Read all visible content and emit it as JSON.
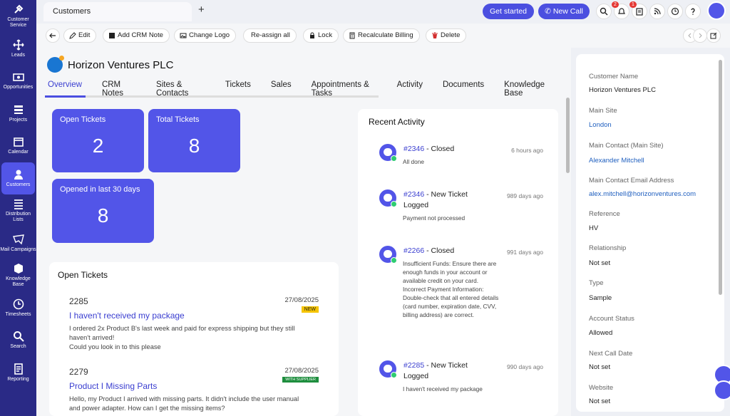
{
  "sidebar": {
    "items": [
      {
        "label": "Customer Service",
        "icon": "wrench-icon"
      },
      {
        "label": "Leads",
        "icon": "move-icon"
      },
      {
        "label": "Opportunities",
        "icon": "money-icon"
      },
      {
        "label": "Projects",
        "icon": "projects-icon"
      },
      {
        "label": "Calendar",
        "icon": "calendar-icon"
      },
      {
        "label": "Customers",
        "icon": "user-icon"
      },
      {
        "label": "Distribution Lists",
        "icon": "list-icon"
      },
      {
        "label": "Mail Campaigns",
        "icon": "mail-icon"
      },
      {
        "label": "Knowledge Base",
        "icon": "box-icon"
      },
      {
        "label": "Timesheets",
        "icon": "clock-icon"
      },
      {
        "label": "Search",
        "icon": "search-icon"
      },
      {
        "label": "Reporting",
        "icon": "report-icon"
      }
    ],
    "active_index": 5
  },
  "topbar": {
    "tab_label": "Customers",
    "plus": "+",
    "get_started": "Get started",
    "new_call": "New Call",
    "notif_badge": "2",
    "tasks_badge": "1"
  },
  "toolbar": {
    "edit": "Edit",
    "add_crm_note": "Add CRM Note",
    "change_logo": "Change Logo",
    "reassign": "Re-assign all",
    "lock": "Lock",
    "recalc": "Recalculate Billing",
    "delete": "Delete"
  },
  "customer": {
    "name": "Horizon Ventures PLC"
  },
  "tabs": [
    "Overview",
    "CRM Notes",
    "Sites & Contacts",
    "Tickets",
    "Sales",
    "Appointments & Tasks",
    "Activity",
    "Documents",
    "Knowledge Base"
  ],
  "stats": {
    "open_tickets_label": "Open Tickets",
    "open_tickets_value": "2",
    "total_tickets_label": "Total Tickets",
    "total_tickets_value": "8",
    "opened_30_label": "Opened in last 30 days",
    "opened_30_value": "8"
  },
  "open_tickets": {
    "title": "Open Tickets",
    "items": [
      {
        "id": "2285",
        "date": "27/08/2025",
        "tag": "NEW",
        "title": "I haven't received my package",
        "desc1": "I ordered 2x Product B's last week and paid for express shipping but they still",
        "desc2": "haven't arrived!",
        "desc3": "Could you look in to this please"
      },
      {
        "id": "2279",
        "date": "27/08/2025",
        "tag": "WITH SUPPLIER",
        "title": "Product I Missing Parts",
        "desc1": "Hello, my Product I arrived with missing parts. It didn't include the user manual",
        "desc2": "and power adapter. How can I get the missing items?"
      }
    ]
  },
  "recent_activity": {
    "title": "Recent Activity",
    "items": [
      {
        "ref": "#2346",
        "text": " - Closed",
        "time": "6 hours ago",
        "desc": "All done"
      },
      {
        "ref": "#2346",
        "text": " - New Ticket Logged",
        "time": "989 days ago",
        "desc": "Payment not processed"
      },
      {
        "ref": "#2266",
        "text": " - Closed",
        "time": "991 days ago",
        "desc": "Insufficient Funds: Ensure there are enough funds in your account or available credit on your card. Incorrect Payment Information: Double-check that all entered details (card number, expiration date, CVV, billing address) are correct."
      },
      {
        "ref": "#2285",
        "text": " - New Ticket Logged",
        "time": "990 days ago",
        "desc": "I haven't received my package"
      }
    ]
  },
  "details": [
    {
      "label": "Customer Name",
      "value": "Horizon Ventures PLC",
      "link": false
    },
    {
      "label": "Main Site",
      "value": "London",
      "link": true
    },
    {
      "label": "Main Contact (Main Site)",
      "value": "Alexander Mitchell",
      "link": true
    },
    {
      "label": "Main Contact Email Address",
      "value": "alex.mitchell@horizonventures.com",
      "link": true
    },
    {
      "label": "Reference",
      "value": "HV",
      "link": false
    },
    {
      "label": "Relationship",
      "value": "Not set",
      "link": false
    },
    {
      "label": "Type",
      "value": "Sample",
      "link": false
    },
    {
      "label": "Account Status",
      "value": "Allowed",
      "link": false
    },
    {
      "label": "Next Call Date",
      "value": "Not set",
      "link": false
    },
    {
      "label": "Website",
      "value": "Not set",
      "link": false
    }
  ],
  "colors": {
    "primary": "#5255e8",
    "sidebar": "#2a2a86",
    "new_tag": "#f5c400",
    "supplier_tag": "#1e8e3e",
    "delete": "#d32f2f"
  }
}
